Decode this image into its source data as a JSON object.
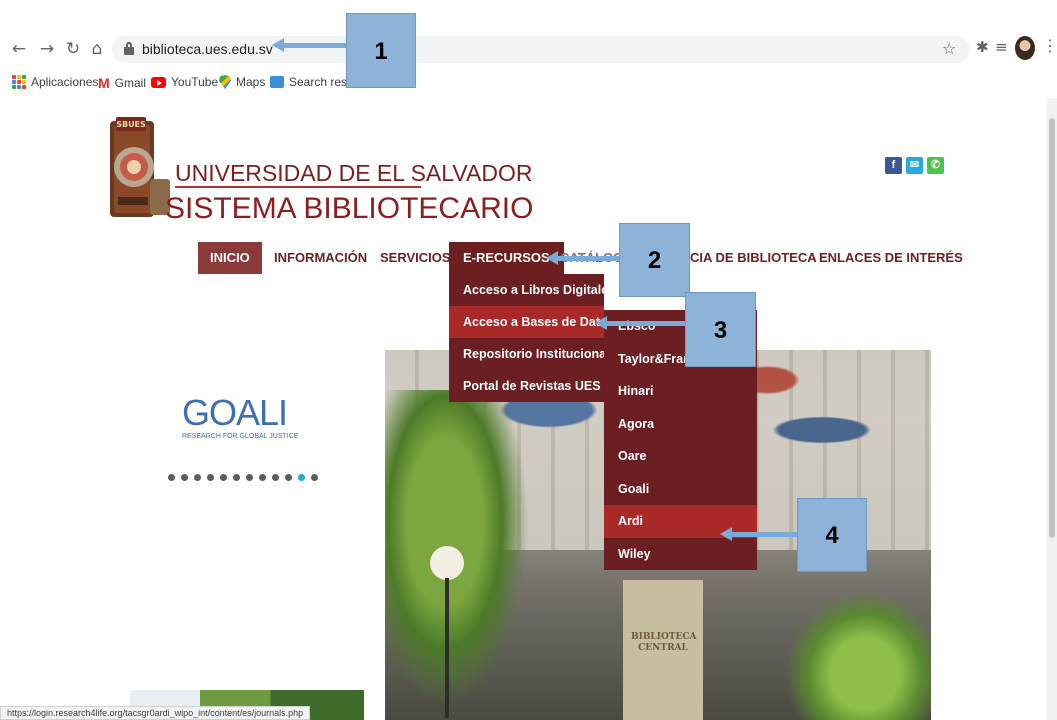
{
  "browser": {
    "url": "biblioteca.ues.edu.sv",
    "bookmarks": [
      {
        "label": "Aplicaciones",
        "icon": "apps-icon"
      },
      {
        "label": "Gmail",
        "icon": "gmail-icon"
      },
      {
        "label": "YouTube",
        "icon": "youtube-icon"
      },
      {
        "label": "Maps",
        "icon": "maps-icon"
      },
      {
        "label": "Search results",
        "icon": "search-results-icon"
      }
    ],
    "status_url": "https://login.research4life.org/tacsgr0ardi_wipo_int/content/es/journals.php"
  },
  "site": {
    "title_line1": "UNIVERSIDAD DE EL SALVADOR",
    "title_line2": "SISTEMA BIBLIOTECARIO",
    "logo_label": "SBUES",
    "social": [
      {
        "icon": "facebook-icon",
        "glyph": "f",
        "color": "#3b5998"
      },
      {
        "icon": "mail-icon",
        "glyph": "✉",
        "color": "#29a9e0"
      },
      {
        "icon": "phone-icon",
        "glyph": "✆",
        "color": "#4cc34c"
      }
    ]
  },
  "nav": {
    "inicio": "INICIO",
    "informacion": "INFORMACIÓN",
    "servicios": "SERVICIOS",
    "erecursos": "E-RECURSOS",
    "catalogo": "CATÁLOGO",
    "asistencia": "CIA DE BIBLIOTECA",
    "enlaces": "ENLACES DE INTERÉS"
  },
  "erecursos_menu": [
    "Acceso a Libros Digitales",
    "Acceso a Bases de Datos",
    "Repositorio Institucional",
    "Portal de Revistas UES"
  ],
  "bases_submenu": [
    "Ebsco",
    "Taylor&Francis",
    "Hinari",
    "Agora",
    "Oare",
    "Goali",
    "Ardi",
    "Wiley"
  ],
  "carousel": {
    "logo_text": "GOALI",
    "logo_sub": "RESEARCH FOR GLOBAL JUSTICE",
    "active_dot": 11,
    "dot_count": 12
  },
  "hero": {
    "sign_text": "BIBLIOTECA CENTRAL"
  },
  "callouts": [
    "1",
    "2",
    "3",
    "4"
  ],
  "colors": {
    "brand_maroon": "#8b1e1e",
    "menu_bg": "#6b1f22",
    "menu_highlight": "#a92828",
    "callout": "#8db3d9"
  }
}
